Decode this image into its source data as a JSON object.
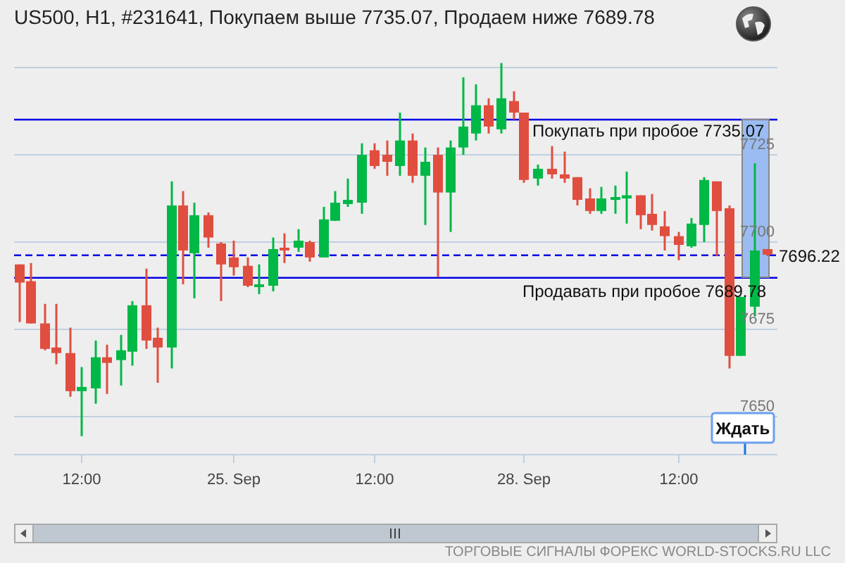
{
  "title": "US500, H1, #231641, Покупаем выше 7735.07, Продаем ниже 7689.78",
  "chart": {
    "buy_line": {
      "label": "Покупать при пробое 7735.07"
    },
    "sell_line": {
      "label": "Продавать при пробое 7689.78"
    },
    "current_price": "7696.22",
    "chart_data": {
      "type": "candlestick",
      "categories": [
        null,
        null,
        null,
        null,
        null,
        "12:00",
        null,
        null,
        null,
        null,
        null,
        null,
        null,
        null,
        null,
        null,
        null,
        "25. Sep",
        null,
        null,
        null,
        null,
        null,
        null,
        null,
        null,
        null,
        null,
        "12:00",
        null,
        null,
        null,
        null,
        null,
        null,
        null,
        null,
        null,
        null,
        null,
        "28. Sep",
        null,
        null,
        null,
        null,
        null,
        null,
        null,
        null,
        null,
        null,
        null,
        "12:00",
        null,
        null,
        null,
        null,
        null,
        null,
        null
      ],
      "ohlc": [
        [
          7693.6,
          7693.6,
          7677.1,
          7688.4
        ],
        [
          7688.8,
          7694.0,
          7676.7,
          7676.7
        ],
        [
          7676.7,
          7682.3,
          7669.0,
          7669.4
        ],
        [
          7669.8,
          7682.3,
          7665.0,
          7668.2
        ],
        [
          7668.2,
          7675.5,
          7655.7,
          7657.3
        ],
        [
          7657.3,
          7664.2,
          7644.4,
          7658.5
        ],
        [
          7658.1,
          7671.8,
          7653.7,
          7667.0
        ],
        [
          7667.0,
          7670.6,
          7656.5,
          7665.4
        ],
        [
          7666.2,
          7673.4,
          7658.9,
          7669.0
        ],
        [
          7668.6,
          7683.1,
          7664.6,
          7681.9
        ],
        [
          7681.9,
          7692.4,
          7669.4,
          7671.8
        ],
        [
          7672.6,
          7675.5,
          7659.7,
          7669.8
        ],
        [
          7669.8,
          7717.4,
          7663.8,
          7710.5
        ],
        [
          7710.5,
          7714.6,
          7687.9,
          7697.6
        ],
        [
          7696.8,
          7711.3,
          7683.9,
          7707.7
        ],
        [
          7707.7,
          7708.5,
          7698.4,
          7701.3
        ],
        [
          7699.6,
          7700.0,
          7683.1,
          7693.6
        ],
        [
          7695.6,
          7700.4,
          7690.4,
          7692.8
        ],
        [
          7693.2,
          7695.6,
          7687.1,
          7687.5
        ],
        [
          7687.1,
          7693.6,
          7685.1,
          7687.9
        ],
        [
          7687.5,
          7701.3,
          7685.9,
          7698.0
        ],
        [
          7698.4,
          7702.5,
          7694.0,
          7697.6
        ],
        [
          7698.4,
          7703.7,
          7697.2,
          7700.4
        ],
        [
          7700.0,
          7700.4,
          7694.4,
          7695.6
        ],
        [
          7695.6,
          7710.1,
          7695.6,
          7706.5
        ],
        [
          7706.1,
          7714.6,
          7706.1,
          7711.3
        ],
        [
          7710.9,
          7718.2,
          7710.1,
          7712.1
        ],
        [
          7711.3,
          7728.3,
          7708.1,
          7725.0
        ],
        [
          7726.3,
          7728.3,
          7721.0,
          7721.8
        ],
        [
          7725.0,
          7729.1,
          7719.0,
          7723.0
        ],
        [
          7721.8,
          7737.1,
          7719.0,
          7729.1
        ],
        [
          7729.1,
          7731.1,
          7717.0,
          7719.0
        ],
        [
          7719.0,
          7727.1,
          7704.9,
          7723.0
        ],
        [
          7725.0,
          7727.1,
          7690.0,
          7714.2
        ],
        [
          7714.2,
          7729.1,
          7702.9,
          7727.1
        ],
        [
          7727.1,
          7747.2,
          7725.0,
          7733.1
        ],
        [
          7731.1,
          7745.2,
          7729.1,
          7739.2
        ],
        [
          7739.2,
          7741.2,
          7731.1,
          7733.1
        ],
        [
          7732.3,
          7751.3,
          7731.1,
          7741.2
        ],
        [
          7740.4,
          7743.2,
          7735.1,
          7737.1
        ],
        [
          7737.1,
          7737.1,
          7717.0,
          7717.8
        ],
        [
          7718.2,
          7722.2,
          7716.2,
          7721.0
        ],
        [
          7721.0,
          7727.5,
          7718.2,
          7719.4
        ],
        [
          7719.4,
          7725.9,
          7717.0,
          7718.2
        ],
        [
          7718.6,
          7718.6,
          7710.5,
          7712.1
        ],
        [
          7712.5,
          7715.4,
          7708.1,
          7708.9
        ],
        [
          7708.9,
          7715.8,
          7708.1,
          7712.5
        ],
        [
          7712.1,
          7716.2,
          7708.1,
          7712.9
        ],
        [
          7712.5,
          7720.2,
          7705.3,
          7713.4
        ],
        [
          7713.4,
          7713.4,
          7703.7,
          7707.7
        ],
        [
          7708.1,
          7713.8,
          7703.3,
          7704.9
        ],
        [
          7704.5,
          7708.9,
          7697.6,
          7701.7
        ],
        [
          7701.7,
          7702.9,
          7694.8,
          7699.2
        ],
        [
          7698.8,
          7706.9,
          7698.4,
          7705.3
        ],
        [
          7704.9,
          7718.6,
          7700.0,
          7717.8
        ],
        [
          7717.4,
          7717.4,
          7696.0,
          7708.9
        ],
        [
          7709.7,
          7710.5,
          7663.8,
          7667.4
        ],
        [
          7667.4,
          7684.3,
          7667.4,
          7684.3
        ],
        [
          7681.5,
          7722.6,
          7678.7,
          7697.6
        ],
        [
          7698.0,
          7698.0,
          7696.0,
          7696.4
        ]
      ],
      "yticks": [
        {
          "value": 7725,
          "label": "7725"
        },
        {
          "value": 7700,
          "label": "7700"
        },
        {
          "value": 7675,
          "label": "7675"
        },
        {
          "value": 7650,
          "label": "7650"
        }
      ],
      "ylim": [
        7639.1,
        7750
      ],
      "grid": true,
      "ref_lines": [
        {
          "axis": "y",
          "value": 7735.07
        },
        {
          "axis": "y",
          "value": 7689.78
        },
        {
          "axis": "y",
          "value": 7696.22
        }
      ]
    },
    "action_button": "Ждать"
  },
  "footer": "ТОРГОВЫЕ СИГНАЛЫ ФОРЕКС WORLD-STOCKS.RU LLC"
}
